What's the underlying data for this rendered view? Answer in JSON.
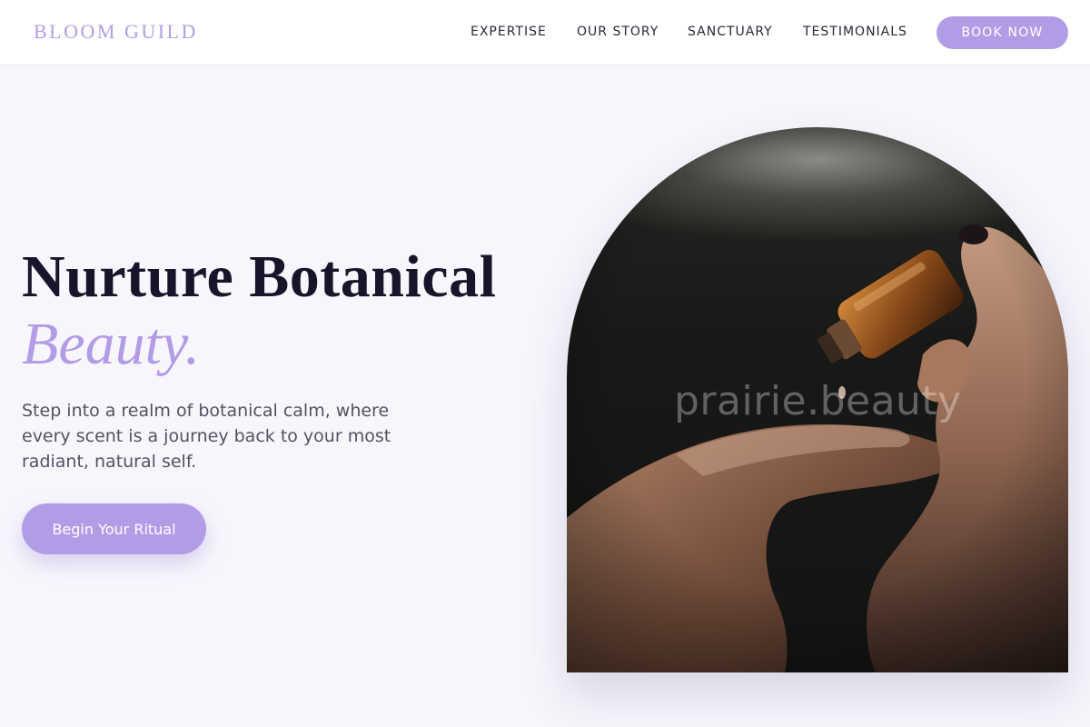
{
  "brand": {
    "name": "BLOOM GUILD",
    "accent_color": "#b39ce6"
  },
  "nav": {
    "items": [
      {
        "label": "EXPERTISE"
      },
      {
        "label": "OUR STORY"
      },
      {
        "label": "SANCTUARY"
      },
      {
        "label": "TESTIMONIALS"
      }
    ],
    "cta_label": "BOOK NOW"
  },
  "hero": {
    "title": "Nurture Botanical",
    "title_accent": "Beauty.",
    "subtitle": "Step into a realm of botanical calm, where every scent is a journey back to your most radiant, natural self.",
    "cta_label": "Begin Your Ritual",
    "image": {
      "watermark": "prairie.beauty"
    }
  }
}
